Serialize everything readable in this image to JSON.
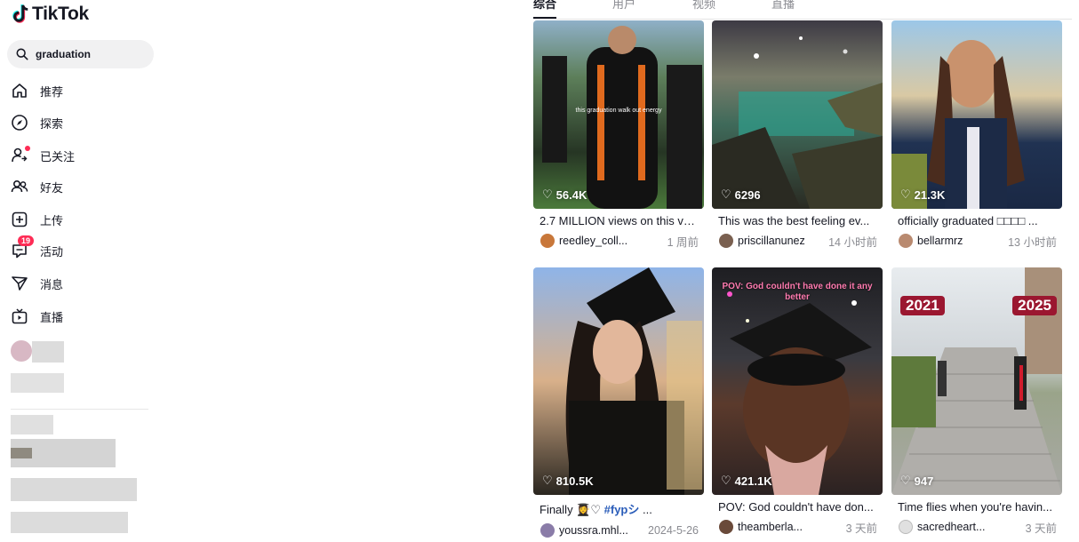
{
  "app": {
    "name": "TikTok"
  },
  "search": {
    "value": "graduation"
  },
  "nav": [
    {
      "label": "推荐",
      "icon": "home-icon"
    },
    {
      "label": "探索",
      "icon": "compass-icon"
    },
    {
      "label": "已关注",
      "icon": "following-icon"
    },
    {
      "label": "好友",
      "icon": "friends-icon"
    },
    {
      "label": "上传",
      "icon": "upload-icon"
    },
    {
      "label": "活动",
      "icon": "activity-icon",
      "badge": "19"
    },
    {
      "label": "消息",
      "icon": "messages-icon"
    },
    {
      "label": "直播",
      "icon": "live-icon"
    }
  ],
  "tabs": [
    "综合",
    "用户",
    "视频",
    "直播"
  ],
  "cards": [
    {
      "likes": "56.4K",
      "desc": "2.7 MILLION views on this vi...",
      "author": "reedley_coll...",
      "time": "1 周前",
      "overlay": "this graduation walk out energy"
    },
    {
      "likes": "6296",
      "desc": "This was the best feeling ev...",
      "author": "priscillanunez",
      "time": "14 小时前"
    },
    {
      "likes": "21.3K",
      "desc": "officially graduated □□□□ ...",
      "author": "bellarmrz",
      "time": "13 小时前"
    },
    {
      "likes": "810.5K",
      "desc_prefix": "Finally ",
      "desc_emoji": "👩‍🎓♡ ",
      "desc_tag": "#fypシ",
      "desc_suffix": " ...",
      "author": "youssra.mhl...",
      "time": "2024-5-26"
    },
    {
      "likes": "421.1K",
      "desc": "POV: God couldn't have don...",
      "author": "theamberla...",
      "time": "3 天前",
      "overlay": "POV: God couldn't have done it any better"
    },
    {
      "likes": "947",
      "desc": "Time flies when you're havin...",
      "author": "sacredheart...",
      "time": "3 天前",
      "year_left": "2021",
      "year_right": "2025"
    }
  ]
}
